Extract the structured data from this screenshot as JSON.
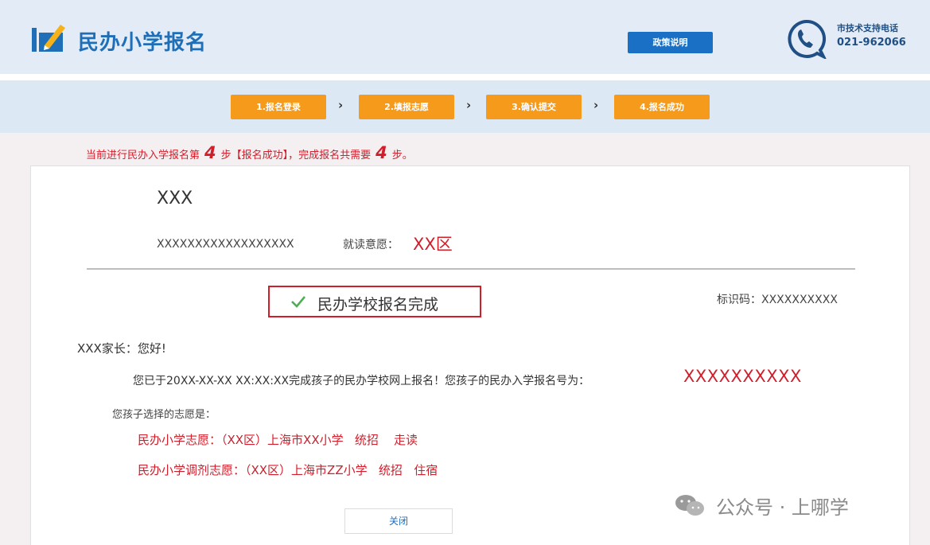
{
  "header": {
    "app_title": "民办小学报名",
    "policy_button": "政策说明",
    "support_label": "市技术支持电话",
    "support_phone": "021-962066",
    "colors": {
      "brand_blue": "#1f6fb8",
      "button_blue": "#1a70c4"
    }
  },
  "steps": {
    "items": [
      {
        "label": "1.报名登录"
      },
      {
        "label": "2.填报志愿"
      },
      {
        "label": "3.确认提交"
      },
      {
        "label": "4.报名成功"
      }
    ],
    "separator": "›",
    "color": "#f59a1b"
  },
  "progress": {
    "prefix": "当前进行民办入学报名第",
    "current_step": "4",
    "middle": "步【报名成功】，完成报名共需要",
    "total_steps": "4",
    "suffix": "步。"
  },
  "result": {
    "student_name": "XXX",
    "student_id": "XXXXXXXXXXXXXXXXXX",
    "preference_label": "就读意愿：",
    "preference_value": "XX区",
    "status_text": "民办学校报名完成",
    "id_code_label": "标识码：",
    "id_code_value": "XXXXXXXXXX",
    "greeting": "XXX家长：您好!",
    "message": "您已于20XX-XX-XX XX:XX:XX完成孩子的民办学校网上报名！您孩子的民办入学报名号为：",
    "registration_no": "XXXXXXXXXX",
    "choices_label": "您孩子选择的志愿是：",
    "choice_primary": "民办小学志愿：（XX区）上海市XX小学   统招    走读",
    "choice_adjust": "民办小学调剂志愿：（XX区）上海市ZZ小学   统招   住宿",
    "close_button": "关闭",
    "accent_red": "#d21d2a"
  },
  "watermark": {
    "text": "公众号 · 上哪学",
    "icon": "wechat-icon"
  }
}
